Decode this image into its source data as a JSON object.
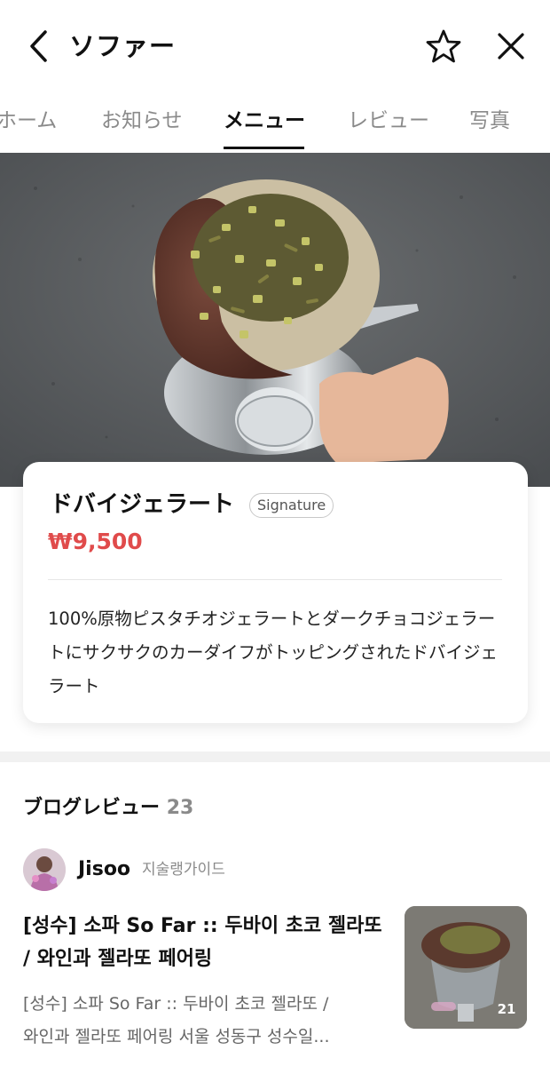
{
  "header": {
    "title": "ソファー",
    "back_icon": "chevron-left-icon",
    "favorite_icon": "star-outline-icon",
    "close_icon": "close-icon"
  },
  "tabs": [
    {
      "label": "ホーム"
    },
    {
      "label": "お知らせ"
    },
    {
      "label": "メニュー"
    },
    {
      "label": "レビュー"
    },
    {
      "label": "写真"
    }
  ],
  "active_tab": "メニュー",
  "menu_item": {
    "name": "ドバイジェラート",
    "badge": "Signature",
    "price": "₩9,500",
    "description": "100%原物ピスタチオジェラートとダークチョコジェラートにサクサクのカーダイフがトッピングされたドバイジェラート"
  },
  "blog": {
    "heading": "ブログレビュー",
    "count": "23",
    "post": {
      "author": "Jisoo",
      "author_tag": "지술랭가이드",
      "title": "[성수] 소파 So Far :: 두바이 초코 젤라또 / 와인과 젤라또 페어링",
      "excerpt_line1": "[성수] 소파 So Far :: 두바이 초코 젤라또 /",
      "excerpt_line2": "와인과 젤라또 페어링 서울 성동구 성수일...",
      "photo_count": "21"
    }
  },
  "colors": {
    "price": "#e04b4b",
    "active_tab": "#111111",
    "inactive_tab": "#8a8a8a"
  }
}
